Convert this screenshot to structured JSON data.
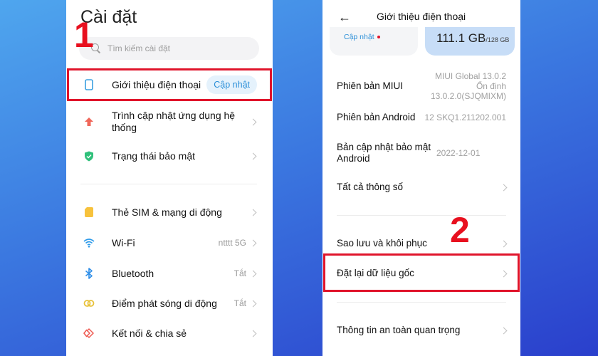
{
  "left_screen": {
    "title": "Cài đặt",
    "search_placeholder": "Tìm kiếm cài đặt",
    "items": [
      {
        "label": "Giới thiệu điện thoại",
        "badge": "Cập nhật",
        "icon": "phone-outline-icon",
        "icon_color": "#3aa0e0"
      },
      {
        "label": "Trình cập nhật ứng dụng hệ thống",
        "icon": "arrow-up-icon",
        "icon_color": "#f0675a"
      },
      {
        "label": "Trạng thái bảo mật",
        "icon": "shield-check-icon",
        "icon_color": "#2fc07a"
      },
      {
        "label": "Thẻ SIM & mạng di động",
        "icon": "sim-card-icon",
        "icon_color": "#f7c23c"
      },
      {
        "label": "Wi-Fi",
        "value": "ntttt 5G",
        "icon": "wifi-icon",
        "icon_color": "#2e9bea"
      },
      {
        "label": "Bluetooth",
        "value": "Tắt",
        "icon": "bluetooth-icon",
        "icon_color": "#2e8ee8"
      },
      {
        "label": "Điểm phát sóng di động",
        "value": "Tắt",
        "icon": "hotspot-icon",
        "icon_color": "#e8c23a"
      },
      {
        "label": "Kết nối & chia sẻ",
        "icon": "connection-share-icon",
        "icon_color": "#ee5a52"
      }
    ]
  },
  "right_screen": {
    "title": "Giới thiệu điện thoại",
    "update_link": "Cập nhật",
    "storage_used": "111.1 GB",
    "storage_total": "/128 GB",
    "info": [
      {
        "label": "Phiên bản MIUI",
        "value_lines": [
          "MIUI Global 13.0.2",
          "Ổn định",
          "13.0.2.0(SJQMIXM)"
        ]
      },
      {
        "label": "Phiên bản Android",
        "value_lines": [
          "12 SKQ1.211202.001"
        ]
      },
      {
        "label": "Bản cập nhật bảo mật Android",
        "value_lines": [
          "2022-12-01"
        ]
      }
    ],
    "menu": [
      {
        "label": "Tất cả thông số"
      },
      {
        "label": "Sao lưu và khôi phục"
      },
      {
        "label": "Đặt lại dữ liệu gốc"
      },
      {
        "label": "Thông tin an toàn quan trọng"
      }
    ]
  },
  "annotations": {
    "step1": "1",
    "step2": "2",
    "highlight_color": "#e0142b"
  }
}
